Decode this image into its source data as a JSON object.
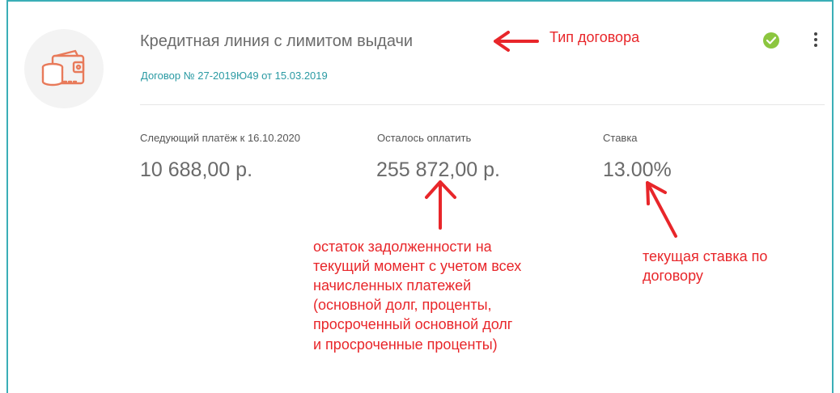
{
  "card": {
    "title": "Кредитная линия с лимитом выдачи",
    "contract": "Договор № 27-2019Ю49 от 15.03.2019",
    "status_icon": "check-circle-icon",
    "menu_icon": "more-vertical-icon",
    "logo_icon": "wallet-coins-icon"
  },
  "stats": [
    {
      "label": "Следующий платёж к 16.10.2020",
      "value": "10 688,00 р."
    },
    {
      "label": "Осталось оплатить",
      "value": "255 872,00 р."
    },
    {
      "label": "Ставка",
      "value": "13.00%"
    }
  ],
  "annotations": {
    "type": "Тип договора",
    "remaining": [
      "остаток задолженности на",
      "текущий момент с учетом всех",
      "начисленных платежей",
      "(основной долг, проценты,",
      "просроченный основной долг",
      "и просроченные проценты)"
    ],
    "rate": [
      "текущая ставка по",
      "договору"
    ]
  },
  "colors": {
    "accent": "#2a9aa3",
    "annotation": "#e8262a",
    "status": "#8cc63f",
    "logo": "#e87a5a"
  }
}
